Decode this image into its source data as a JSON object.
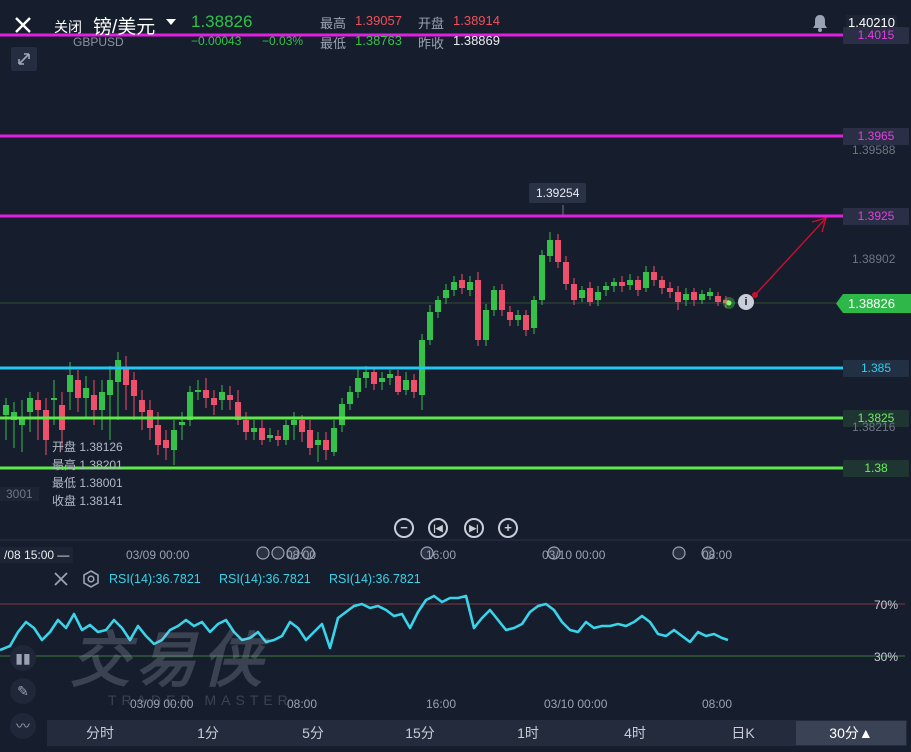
{
  "header": {
    "close_label": "关闭",
    "instrument": "镑/美元",
    "instrument_code": "GBPUSD",
    "last_price": "1.38826",
    "change": "−0.00043",
    "change_pct": "−0.03%",
    "high_label": "最高",
    "high": "1.39057",
    "open_label": "开盘",
    "open": "1.38914",
    "low_label": "最低",
    "low": "1.38763",
    "prev_close_label": "昨收",
    "prev_close": "1.38869",
    "top_axis_price": "1.40210"
  },
  "levels": [
    {
      "label": "1.4015",
      "color": "#e020e0"
    },
    {
      "label": "1.3965",
      "color": "#e020e0"
    },
    {
      "label": "1.3925",
      "color": "#e020e0"
    },
    {
      "label": "1.385",
      "color": "#22c8f0"
    },
    {
      "label": "1.3825",
      "color": "#5fe84a"
    },
    {
      "label": "1.38",
      "color": "#5fe84a"
    }
  ],
  "axis_labels": [
    "1.39588",
    "1.38902",
    "1.38216"
  ],
  "current_price_tag": "1.38826",
  "peak_label": "1.39254",
  "ohlc_box": {
    "open": "开盘 1.38126",
    "high": "最高 1.38201",
    "low": "最低 1.38001",
    "close": "收盘 1.38141",
    "left_axis": "3001"
  },
  "time_axis": {
    "cursor": "/08 15:00 —",
    "labels": [
      "03/09 00:00",
      "08:00",
      "16:00",
      "03/10 00:00",
      "08:00"
    ]
  },
  "rsi": {
    "label1": "RSI(14):36.7821",
    "label2": "RSI(14):36.7821",
    "label3": "RSI(14):36.7821",
    "level_70": "70%",
    "level_30": "30%",
    "time_labels": [
      "03/09 00:00",
      "08:00",
      "16:00",
      "03/10 00:00",
      "08:00"
    ],
    "color": "#39d3ea"
  },
  "watermark": {
    "cn": "交易侠",
    "en": "TRADER MASTER"
  },
  "timeframes": [
    "分时",
    "1分",
    "5分",
    "15分",
    "1时",
    "4时",
    "日K",
    "30分▲"
  ],
  "active_timeframe": "30分",
  "colors": {
    "bull": "#35c04a",
    "bear": "#ee4f6b",
    "bg": "#161d2c"
  }
}
